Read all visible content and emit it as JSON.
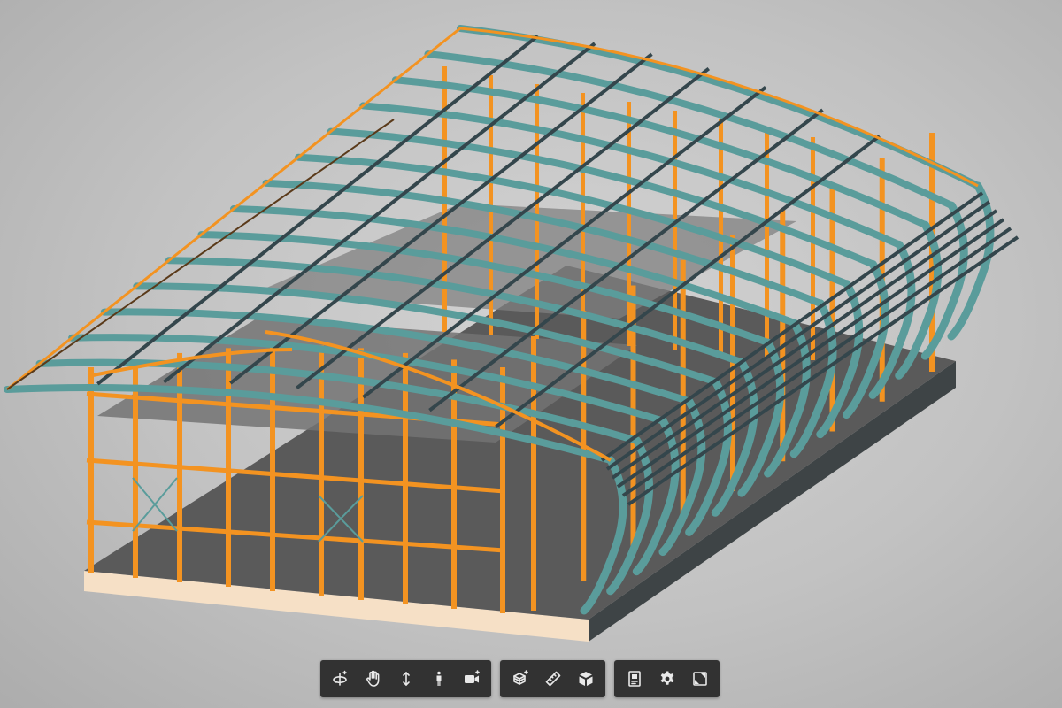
{
  "colors": {
    "background": "#c6c6c6",
    "steel_frame_orange": "#f39321",
    "roof_rafter_teal": "#5a9c9b",
    "purlin_dark": "#34464c",
    "floor_slab": "#5a5a5a",
    "foundation_face": "#f6e0c6",
    "toolbar_bg": "#323232",
    "icon": "#e9e9e9"
  },
  "toolbar": {
    "groups": [
      {
        "name": "navigation",
        "tools": [
          "orbit-icon",
          "pan-hand-icon",
          "zoom-icon",
          "first-person-icon",
          "camera-icon"
        ]
      },
      {
        "name": "modeling",
        "tools": [
          "section-box-icon",
          "measure-ruler-icon",
          "explode-cube-icon"
        ]
      },
      {
        "name": "properties",
        "tools": [
          "model-browser-icon",
          "settings-gear-icon",
          "fullscreen-icon"
        ]
      }
    ]
  }
}
